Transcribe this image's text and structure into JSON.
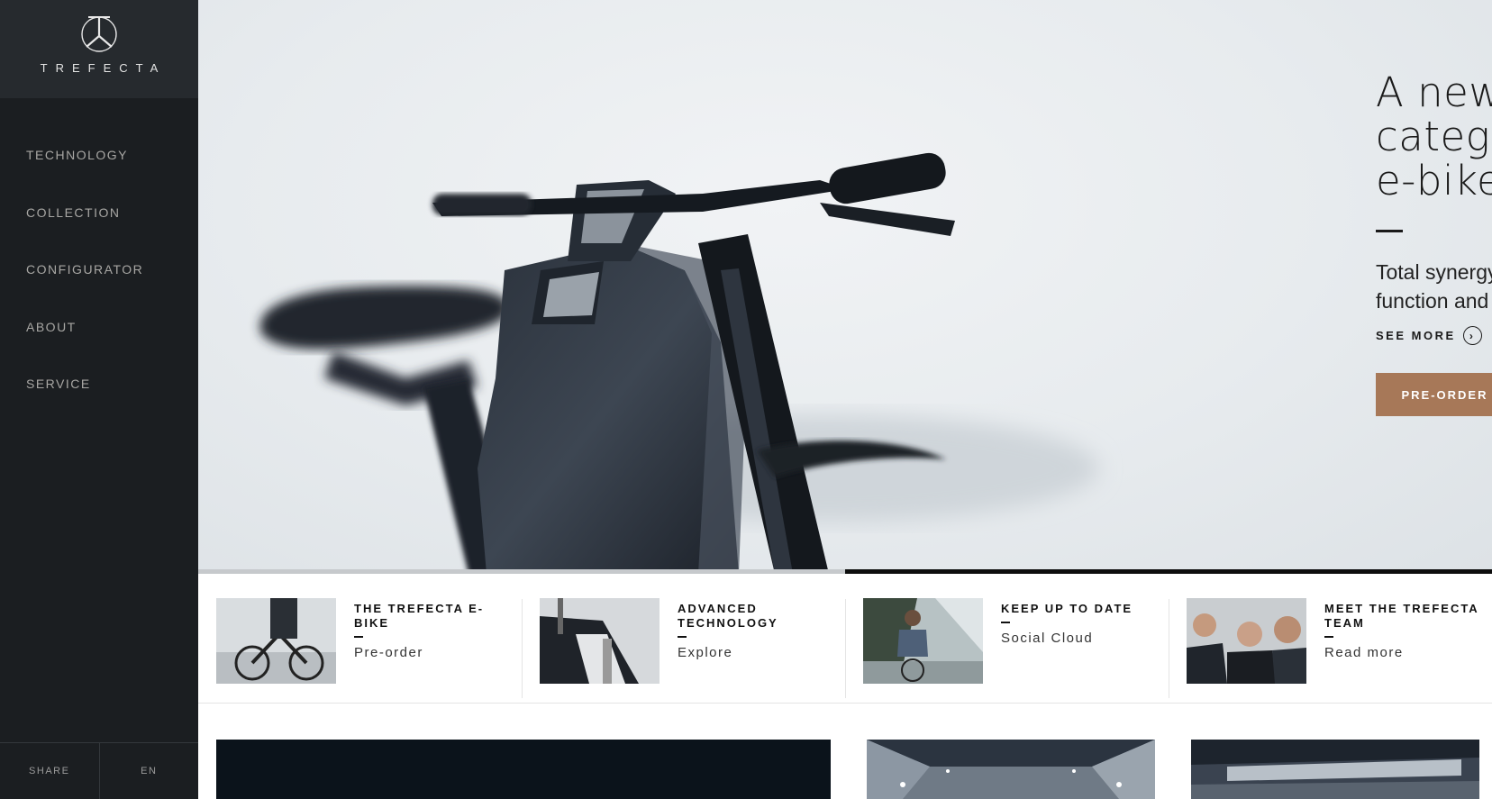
{
  "brand": {
    "name": "TREFECTA",
    "logo_icon": "trefecta-logo-icon"
  },
  "nav": {
    "items": [
      {
        "label": "TECHNOLOGY"
      },
      {
        "label": "COLLECTION"
      },
      {
        "label": "CONFIGURATOR"
      },
      {
        "label": "ABOUT"
      },
      {
        "label": "SERVICE"
      }
    ]
  },
  "footer": {
    "share_label": "SHARE",
    "language_label": "EN"
  },
  "hero": {
    "title_line1": "A new",
    "title_line2": "category",
    "title_line3": "e-bike",
    "subtitle": "Total synergy between power, function and design",
    "see_more_label": "SEE MORE",
    "see_more_icon": "chevron-right-circle-icon",
    "preorder_label": "PRE-ORDER",
    "slider_progress": 0.5,
    "colors": {
      "accent": "#a77858",
      "sidebar": "#1b1e21",
      "logo_box": "#262a2e"
    }
  },
  "cards": [
    {
      "title": "THE TREFECTA E-BIKE",
      "link": "Pre-order"
    },
    {
      "title": "ADVANCED TECHNOLOGY",
      "link": "Explore"
    },
    {
      "title": "KEEP UP TO DATE",
      "link": "Social Cloud"
    },
    {
      "title": "MEET THE TREFECTA TEAM",
      "link": "Read more"
    }
  ]
}
